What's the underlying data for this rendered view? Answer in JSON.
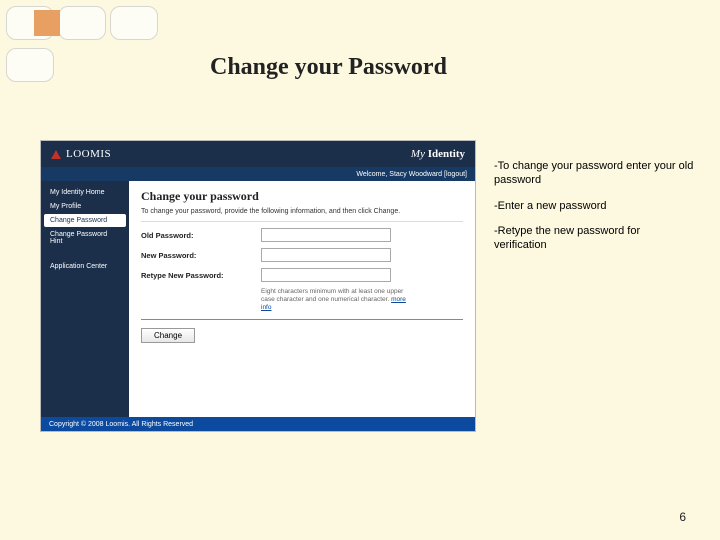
{
  "slide": {
    "title": "Change your Password",
    "page_number": "6"
  },
  "topbar": {
    "brand": "LOOMIS",
    "product_prefix": "My",
    "product_word": "Identity"
  },
  "welcome": {
    "text": "Welcome, Stacy Woodward",
    "logout_label": "[logout]"
  },
  "sidebar": {
    "items": [
      {
        "label": "My Identity Home"
      },
      {
        "label": "My Profile"
      },
      {
        "label": "Change Password"
      },
      {
        "label": "Change Password Hint"
      },
      {
        "label": "Application Center"
      }
    ]
  },
  "content": {
    "heading": "Change your password",
    "intro": "To change your password, provide the following information, and then click Change.",
    "fields": {
      "old_label": "Old Password:",
      "new_label": "New Password:",
      "retype_label": "Retype New Password:"
    },
    "hint": "Eight characters minimum with at least one upper case character and one numerical character.",
    "hint_link": "more info",
    "change_button": "Change"
  },
  "footer": {
    "copyright": "Copyright © 2008 Loomis. All Rights Reserved"
  },
  "callouts": {
    "line1": "-To change your password enter your old password",
    "line2": "-Enter a new password",
    "line3": "-Retype the new password for verification"
  }
}
